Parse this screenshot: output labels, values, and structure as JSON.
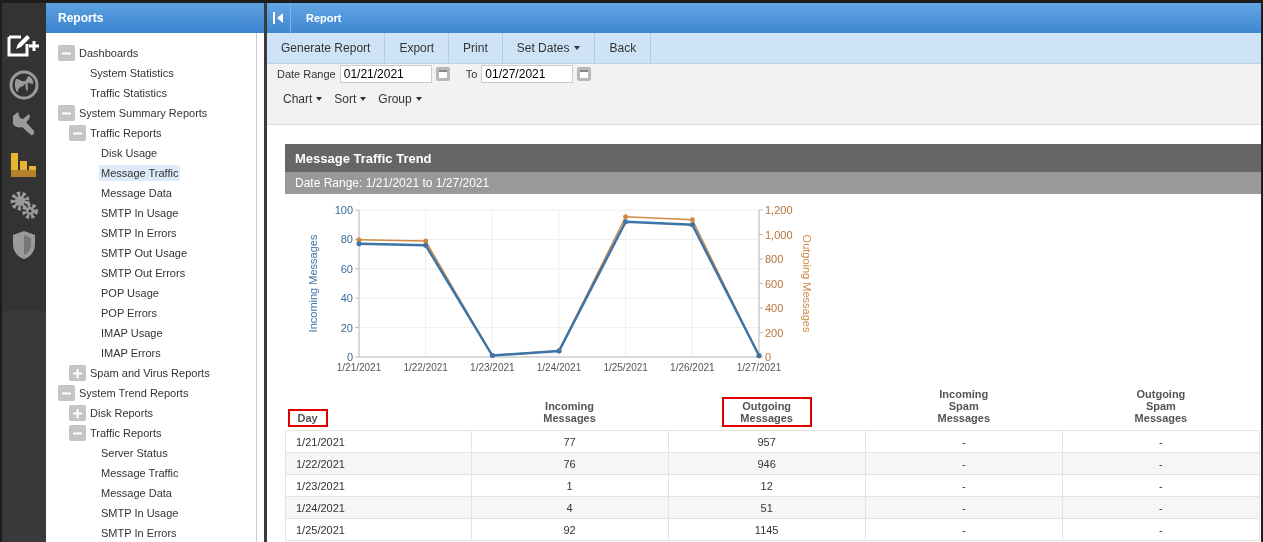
{
  "rail": [
    {
      "selected": false
    },
    {
      "selected": false
    },
    {
      "selected": false
    },
    {
      "selected": true
    },
    {
      "selected": false
    },
    {
      "selected": false
    }
  ],
  "sidebar": {
    "title": "Reports",
    "items": [
      {
        "label": "Dashboards",
        "expanded": true,
        "children": [
          {
            "label": "System Statistics",
            "selected": false
          },
          {
            "label": "Traffic Statistics",
            "selected": false
          }
        ]
      },
      {
        "label": "System Summary Reports",
        "expanded": true,
        "children": [
          {
            "label": "Traffic Reports",
            "expanded": true,
            "children": [
              {
                "label": "Disk Usage",
                "selected": false
              },
              {
                "label": "Message Traffic",
                "selected": true
              },
              {
                "label": "Message Data",
                "selected": false
              },
              {
                "label": "SMTP In Usage",
                "selected": false
              },
              {
                "label": "SMTP In Errors",
                "selected": false
              },
              {
                "label": "SMTP Out Usage",
                "selected": false
              },
              {
                "label": "SMTP Out Errors",
                "selected": false
              },
              {
                "label": "POP Usage",
                "selected": false
              },
              {
                "label": "POP Errors",
                "selected": false
              },
              {
                "label": "IMAP Usage",
                "selected": false
              },
              {
                "label": "IMAP Errors",
                "selected": false
              }
            ]
          },
          {
            "label": "Spam and Virus Reports",
            "expanded": false
          }
        ]
      },
      {
        "label": "System Trend Reports",
        "expanded": true,
        "children": [
          {
            "label": "Disk Reports",
            "expanded": false
          },
          {
            "label": "Traffic Reports",
            "expanded": true,
            "children": [
              {
                "label": "Server Status",
                "selected": false
              },
              {
                "label": "Message Traffic",
                "selected": false
              },
              {
                "label": "Message Data",
                "selected": false
              },
              {
                "label": "SMTP In Usage",
                "selected": false
              },
              {
                "label": "SMTP In Errors",
                "selected": false
              }
            ]
          }
        ]
      }
    ]
  },
  "main": {
    "title": "Report",
    "toolbar": [
      {
        "label": "Generate Report",
        "dropdown": false
      },
      {
        "label": "Export",
        "dropdown": false
      },
      {
        "label": "Print",
        "dropdown": false
      },
      {
        "label": "Set Dates",
        "dropdown": true
      },
      {
        "label": "Back",
        "dropdown": false
      }
    ],
    "date_range": {
      "label": "Date Range",
      "from": "01/21/2021",
      "to_label": "To",
      "to": "01/27/2021"
    },
    "menus": [
      "Chart",
      "Sort",
      "Group"
    ],
    "report": {
      "title": "Message Traffic Trend",
      "subtitle": "Date Range: 1/21/2021 to 1/27/2021",
      "chart_data": {
        "type": "line",
        "grid": true,
        "categories": [
          "1/21/2021",
          "1/22/2021",
          "1/23/2021",
          "1/24/2021",
          "1/25/2021",
          "1/26/2021",
          "1/27/2021"
        ],
        "ylim": [
          0,
          100
        ],
        "yticks": [
          0,
          20,
          40,
          60,
          80,
          100
        ],
        "y2lim": [
          0,
          1200
        ],
        "y2ticks": [
          {
            "value": 0,
            "label": "0"
          },
          {
            "value": 200,
            "label": "200"
          },
          {
            "value": 400,
            "label": "400"
          },
          {
            "value": 600,
            "label": "600"
          },
          {
            "value": 800,
            "label": "800"
          },
          {
            "value": 1000,
            "label": "1,000"
          },
          {
            "value": 1200,
            "label": "1,200"
          }
        ],
        "series": [
          {
            "name": "Incoming Messages",
            "color": "#3d74a8",
            "values": [
              77,
              76,
              1,
              4,
              92,
              90,
              1
            ]
          },
          {
            "name": "Outgoing Messages",
            "color": "#d08a45",
            "axis": "y2",
            "values": [
              957,
              946,
              12,
              51,
              1145,
              1120,
              8
            ]
          }
        ]
      },
      "table": {
        "columns": [
          {
            "label": "Day",
            "highlighted": true
          },
          {
            "label": "Incoming Messages",
            "highlighted": false
          },
          {
            "label": "Outgoing Messages",
            "highlighted": true
          },
          {
            "label": "Incoming Spam Messages",
            "highlighted": false
          },
          {
            "label": "Outgoing Spam Messages",
            "highlighted": false
          }
        ],
        "rows": [
          [
            "1/21/2021",
            "77",
            "957",
            "-",
            "-"
          ],
          [
            "1/22/2021",
            "76",
            "946",
            "-",
            "-"
          ],
          [
            "1/23/2021",
            "1",
            "12",
            "-",
            "-"
          ],
          [
            "1/24/2021",
            "4",
            "51",
            "-",
            "-"
          ],
          [
            "1/25/2021",
            "92",
            "1145",
            "-",
            "-"
          ]
        ]
      }
    }
  }
}
